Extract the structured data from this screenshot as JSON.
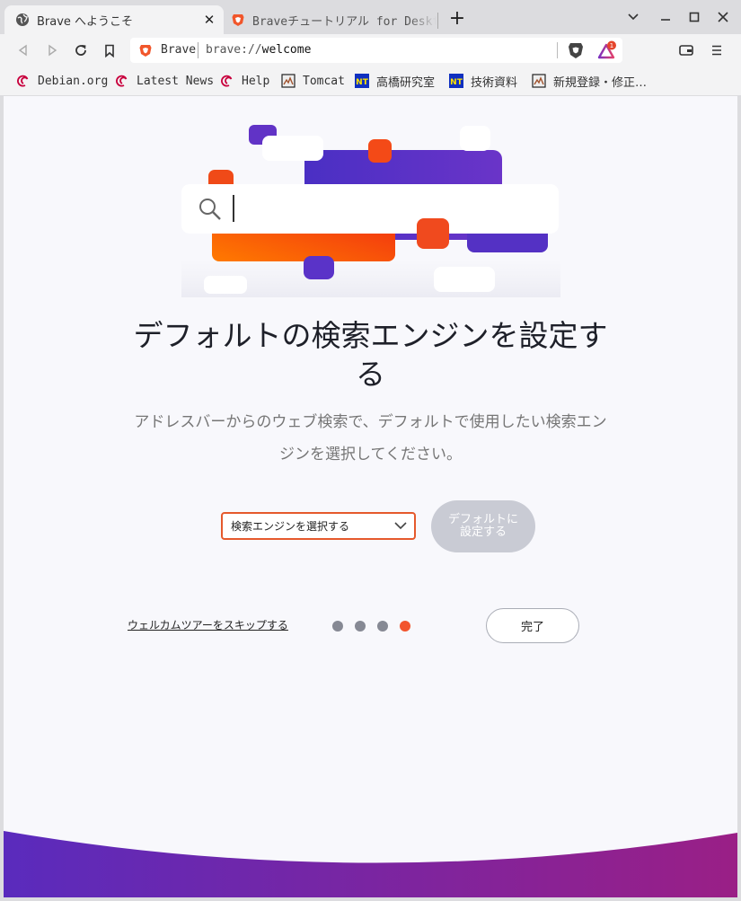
{
  "tabs": [
    {
      "label": "Brave へようこそ",
      "icon": "globe-icon"
    },
    {
      "label": "Braveチュートリアル for Desktop",
      "icon": "brave-lion-icon"
    }
  ],
  "toolbar": {
    "site_label": "Brave",
    "url_prefix": "brave://",
    "url_host": "welcome",
    "rewards_badge": "1"
  },
  "bookmarks": [
    {
      "label": "Debian.org",
      "icon": "debian-swirl-icon"
    },
    {
      "label": "Latest News",
      "icon": "debian-swirl-icon"
    },
    {
      "label": "Help",
      "icon": "debian-swirl-icon"
    },
    {
      "label": "Tomcat",
      "icon": "tomcat-page-icon"
    },
    {
      "label": "高橋研究室",
      "icon": "nt-icon"
    },
    {
      "label": "技術資料",
      "icon": "nt-icon"
    },
    {
      "label": "新規登録・修正…",
      "icon": "page-icon"
    }
  ],
  "welcome": {
    "heading": "デフォルトの検索エンジンを設定する",
    "description": "アドレスバーからのウェブ検索で、デフォルトで使用したい検索エンジンを選択してください。",
    "select_placeholder": "検索エンジンを選択する",
    "set_default_label": "デフォルトに設定する",
    "skip_label": "ウェルカムツアーをスキップする",
    "done_label": "完了",
    "steps_total": 4,
    "current_step": 4
  },
  "colors": {
    "accent": "#e5592c",
    "brand_purple": "#5a2fc0",
    "brand_orange": "#f2542d",
    "disabled_button": "#c9cbd4"
  }
}
